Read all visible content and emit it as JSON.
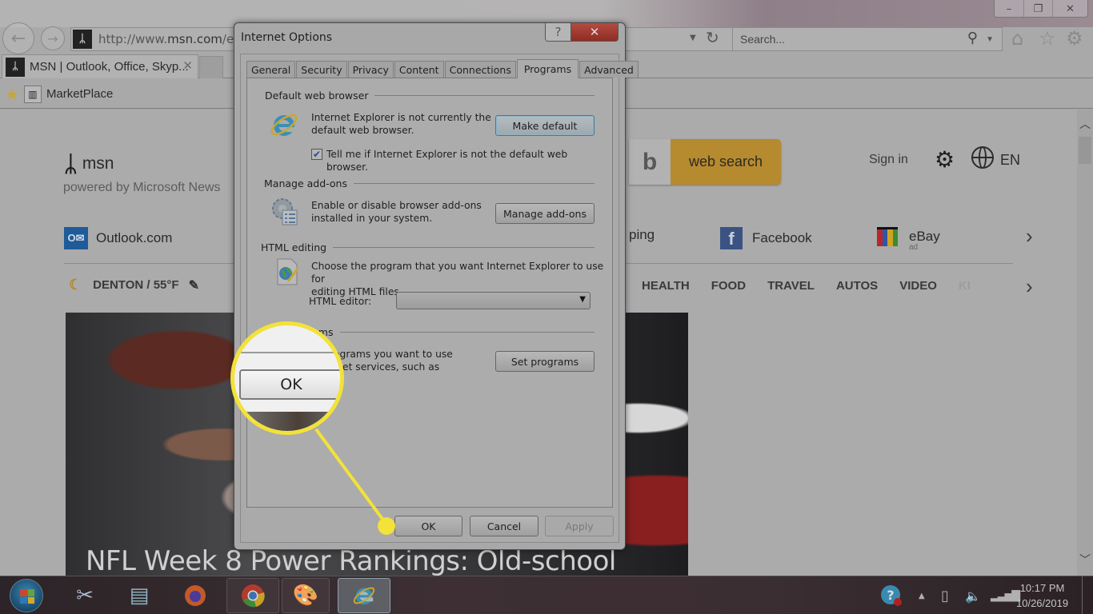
{
  "browser": {
    "window_controls": {
      "minimize": "–",
      "restore": "❐",
      "close": "✕"
    },
    "address_url_prefix": "http://www.",
    "address_url_domain": "msn.com",
    "address_url_suffix": "/en-us",
    "search_placeholder": "Search...",
    "tab": {
      "title": "MSN | Outlook, Office, Skyp...",
      "close": "✕"
    },
    "favorites": [
      {
        "label": "MarketPlace"
      }
    ],
    "icons": {
      "home": "⌂",
      "favorites": "☆",
      "tools": "⚙",
      "back": "←",
      "forward": "→",
      "refresh": "↻",
      "search": "⚲"
    }
  },
  "msn": {
    "brand": "msn",
    "tagline": "powered by Microsoft News",
    "search_button": "web search",
    "sign_in": "Sign in",
    "language": "EN",
    "quick_links": [
      {
        "label": "Outlook.com"
      },
      {
        "label": "ping"
      },
      {
        "label": "Facebook"
      },
      {
        "label": "eBay",
        "sublabel": "ad"
      }
    ],
    "weather": "DENTON / 55°F",
    "categories": [
      "HEALTH",
      "FOOD",
      "TRAVEL",
      "AUTOS",
      "VIDEO",
      "KI"
    ],
    "headline": "NFL Week 8 Power Rankings: Old-school"
  },
  "dialog": {
    "title": "Internet Options",
    "help": "?",
    "close": "✕",
    "tabs": [
      {
        "label": "General",
        "active": false
      },
      {
        "label": "Security",
        "active": false
      },
      {
        "label": "Privacy",
        "active": false
      },
      {
        "label": "Content",
        "active": false
      },
      {
        "label": "Connections",
        "active": false
      },
      {
        "label": "Programs",
        "active": true
      },
      {
        "label": "Advanced",
        "active": false
      }
    ],
    "default_browser": {
      "heading": "Default web browser",
      "text_line1": "Internet Explorer is not currently the",
      "text_line2": "default web browser.",
      "button": "Make default",
      "checkbox_label": "Tell me if Internet Explorer is not the default web browser.",
      "checkbox_checked": true
    },
    "addons": {
      "heading": "Manage add-ons",
      "text_line1": "Enable or disable browser add-ons",
      "text_line2": "installed in your system.",
      "button": "Manage add-ons"
    },
    "html_editing": {
      "heading": "HTML editing",
      "text_line1": "Choose the program that you want Internet Explorer to use for",
      "text_line2": "editing HTML files.",
      "editor_label": "HTML editor:",
      "editor_value": ""
    },
    "internet_programs": {
      "heading_visible": "rams",
      "text_line1_visible": "ograms you want to use",
      "text_line2_visible": "et services, such as",
      "button": "Set programs"
    },
    "footer": {
      "ok": "OK",
      "cancel": "Cancel",
      "apply": "Apply",
      "apply_disabled": true
    }
  },
  "callout": {
    "label": "OK",
    "color": "#f2e23a"
  },
  "taskbar": {
    "apps": [
      "start",
      "snipping-tool",
      "notepad",
      "firefox",
      "chrome",
      "paint",
      "internet-explorer"
    ],
    "clock_time": "10:17 PM",
    "clock_date": "10/26/2019"
  }
}
